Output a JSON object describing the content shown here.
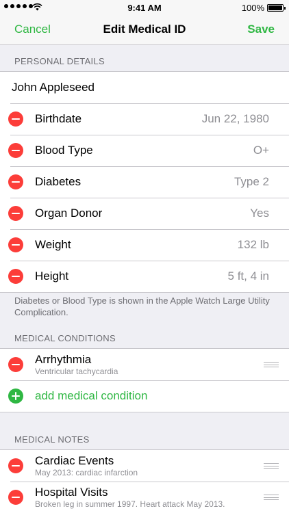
{
  "status_bar": {
    "time": "9:41 AM",
    "battery": "100%"
  },
  "nav": {
    "cancel": "Cancel",
    "title": "Edit Medical ID",
    "save": "Save"
  },
  "personal": {
    "header": "PERSONAL DETAILS",
    "name": "John Appleseed",
    "rows": [
      {
        "label": "Birthdate",
        "value": "Jun 22, 1980"
      },
      {
        "label": "Blood Type",
        "value": "O+"
      },
      {
        "label": "Diabetes",
        "value": "Type 2"
      },
      {
        "label": "Organ Donor",
        "value": "Yes"
      },
      {
        "label": "Weight",
        "value": "132 lb"
      },
      {
        "label": "Height",
        "value": "5 ft, 4 in"
      }
    ],
    "footer": "Diabetes or Blood Type is shown in the Apple Watch Large Utility Complication."
  },
  "conditions": {
    "header": "MEDICAL CONDITIONS",
    "items": [
      {
        "title": "Arrhythmia",
        "subtitle": "Ventricular tachycardia"
      }
    ],
    "add_label": "add medical condition"
  },
  "notes": {
    "header": "MEDICAL NOTES",
    "items": [
      {
        "title": "Cardiac Events",
        "subtitle": "May 2013: cardiac infarction"
      },
      {
        "title": "Hospital Visits",
        "subtitle": "Broken leg in summer 1997.  Heart attack May 2013."
      }
    ]
  }
}
